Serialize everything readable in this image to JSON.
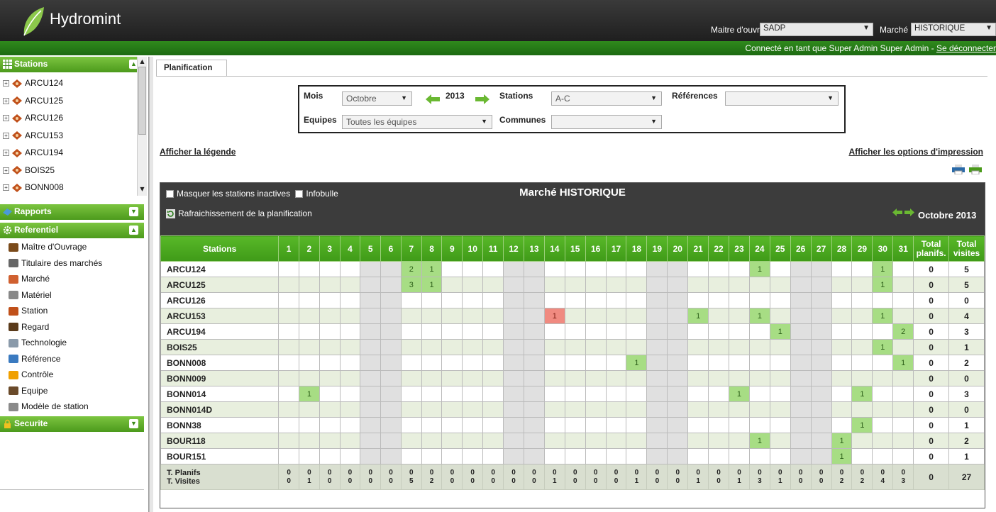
{
  "app": {
    "title": "Hydromint"
  },
  "header": {
    "owner_label": "Maitre d'ouvrage",
    "owner_value": "SADP",
    "market_label": "Marché",
    "market_value": "HISTORIQUE",
    "connected_text": "Connecté en tant que  Super Admin Super Admin  - ",
    "logout_label": "Se déconnecter"
  },
  "sidebar": {
    "stations_title": "Stations",
    "stations": [
      "ARCU124",
      "ARCU125",
      "ARCU126",
      "ARCU153",
      "ARCU194",
      "BOIS25",
      "BONN008"
    ],
    "rapports_title": "Rapports",
    "referentiel_title": "Referentiel",
    "referentiel_items": [
      {
        "label": "Maître d'Ouvrage",
        "icon": "building-icon",
        "color": "#7a4a1a"
      },
      {
        "label": "Titulaire des marchés",
        "icon": "truck-icon",
        "color": "#666666"
      },
      {
        "label": "Marché",
        "icon": "chart-icon",
        "color": "#d06030"
      },
      {
        "label": "Matériel",
        "icon": "tools-icon",
        "color": "#888888"
      },
      {
        "label": "Station",
        "icon": "station-icon",
        "color": "#c0501a"
      },
      {
        "label": "Regard",
        "icon": "manhole-icon",
        "color": "#5a3a1a"
      },
      {
        "label": "Technologie",
        "icon": "gear-icon",
        "color": "#8a9aaa"
      },
      {
        "label": "Référence",
        "icon": "drop-icon",
        "color": "#3a7ac0"
      },
      {
        "label": "Contrôle",
        "icon": "warning-icon",
        "color": "#f0a000"
      },
      {
        "label": "Equipe",
        "icon": "team-icon",
        "color": "#6a4a2a"
      },
      {
        "label": "Modèle de station",
        "icon": "template-icon",
        "color": "#8a8a8a"
      }
    ],
    "securite_title": "Securite"
  },
  "tabs": {
    "planification": "Planification"
  },
  "filters": {
    "mois_label": "Mois",
    "mois_value": "Octobre",
    "year": "2013",
    "stations_label": "Stations",
    "stations_value": "A-C",
    "references_label": "Références",
    "references_value": "",
    "equipes_label": "Equipes",
    "equipes_value": "Toutes les équipes",
    "communes_label": "Communes",
    "communes_value": ""
  },
  "links": {
    "legend": "Afficher la légende",
    "print_options": "Afficher les options d'impression"
  },
  "grid": {
    "hide_inactive": "Masquer les stations inactives",
    "tooltip": "Infobulle",
    "refresh": "Rafraichissement de la planification",
    "title": "Marché HISTORIQUE",
    "period": "Octobre 2013",
    "station_header": "Stations",
    "total_planifs_header": "Total planifs.",
    "total_visites_header": "Total visites",
    "days": [
      "1",
      "2",
      "3",
      "4",
      "5",
      "6",
      "7",
      "8",
      "9",
      "10",
      "11",
      "12",
      "13",
      "14",
      "15",
      "16",
      "17",
      "18",
      "19",
      "20",
      "21",
      "22",
      "23",
      "24",
      "25",
      "26",
      "27",
      "28",
      "29",
      "30",
      "31"
    ],
    "weekend_days": [
      5,
      6,
      12,
      13,
      19,
      20,
      26,
      27
    ],
    "rows": [
      {
        "station": "ARCU124",
        "cells": {
          "7": "2",
          "8": "1",
          "24": "1",
          "30": "1"
        },
        "planifs": "0",
        "visites": "5"
      },
      {
        "station": "ARCU125",
        "cells": {
          "7": "3",
          "8": "1",
          "30": "1"
        },
        "planifs": "0",
        "visites": "5"
      },
      {
        "station": "ARCU126",
        "cells": {},
        "planifs": "0",
        "visites": "0"
      },
      {
        "station": "ARCU153",
        "cells": {
          "14": "1",
          "21": "1",
          "24": "1",
          "30": "1"
        },
        "red": [
          "14"
        ],
        "planifs": "0",
        "visites": "4"
      },
      {
        "station": "ARCU194",
        "cells": {
          "25": "1",
          "31": "2"
        },
        "planifs": "0",
        "visites": "3"
      },
      {
        "station": "BOIS25",
        "cells": {
          "30": "1"
        },
        "planifs": "0",
        "visites": "1"
      },
      {
        "station": "BONN008",
        "cells": {
          "18": "1",
          "31": "1"
        },
        "planifs": "0",
        "visites": "2"
      },
      {
        "station": "BONN009",
        "cells": {},
        "planifs": "0",
        "visites": "0"
      },
      {
        "station": "BONN014",
        "cells": {
          "2": "1",
          "23": "1",
          "29": "1"
        },
        "planifs": "0",
        "visites": "3"
      },
      {
        "station": "BONN014D",
        "cells": {},
        "planifs": "0",
        "visites": "0"
      },
      {
        "station": "BONN38",
        "cells": {
          "29": "1"
        },
        "planifs": "0",
        "visites": "1"
      },
      {
        "station": "BOUR118",
        "cells": {
          "24": "1",
          "28": "1"
        },
        "planifs": "0",
        "visites": "2"
      },
      {
        "station": "BOUR151",
        "cells": {
          "28": "1"
        },
        "planifs": "0",
        "visites": "1"
      }
    ],
    "footer_label_planifs": "T. Planifs",
    "footer_label_visites": "T. Visites",
    "footer_planifs": [
      "0",
      "0",
      "0",
      "0",
      "0",
      "0",
      "0",
      "0",
      "0",
      "0",
      "0",
      "0",
      "0",
      "0",
      "0",
      "0",
      "0",
      "0",
      "0",
      "0",
      "0",
      "0",
      "0",
      "0",
      "0",
      "0",
      "0",
      "0",
      "0",
      "0",
      "0"
    ],
    "footer_visites": [
      "0",
      "1",
      "0",
      "0",
      "0",
      "0",
      "5",
      "2",
      "0",
      "0",
      "0",
      "0",
      "0",
      "1",
      "0",
      "0",
      "0",
      "1",
      "0",
      "0",
      "1",
      "0",
      "1",
      "3",
      "1",
      "0",
      "0",
      "2",
      "2",
      "4",
      "3"
    ],
    "footer_total_planifs": "0",
    "footer_total_visites": "27"
  }
}
